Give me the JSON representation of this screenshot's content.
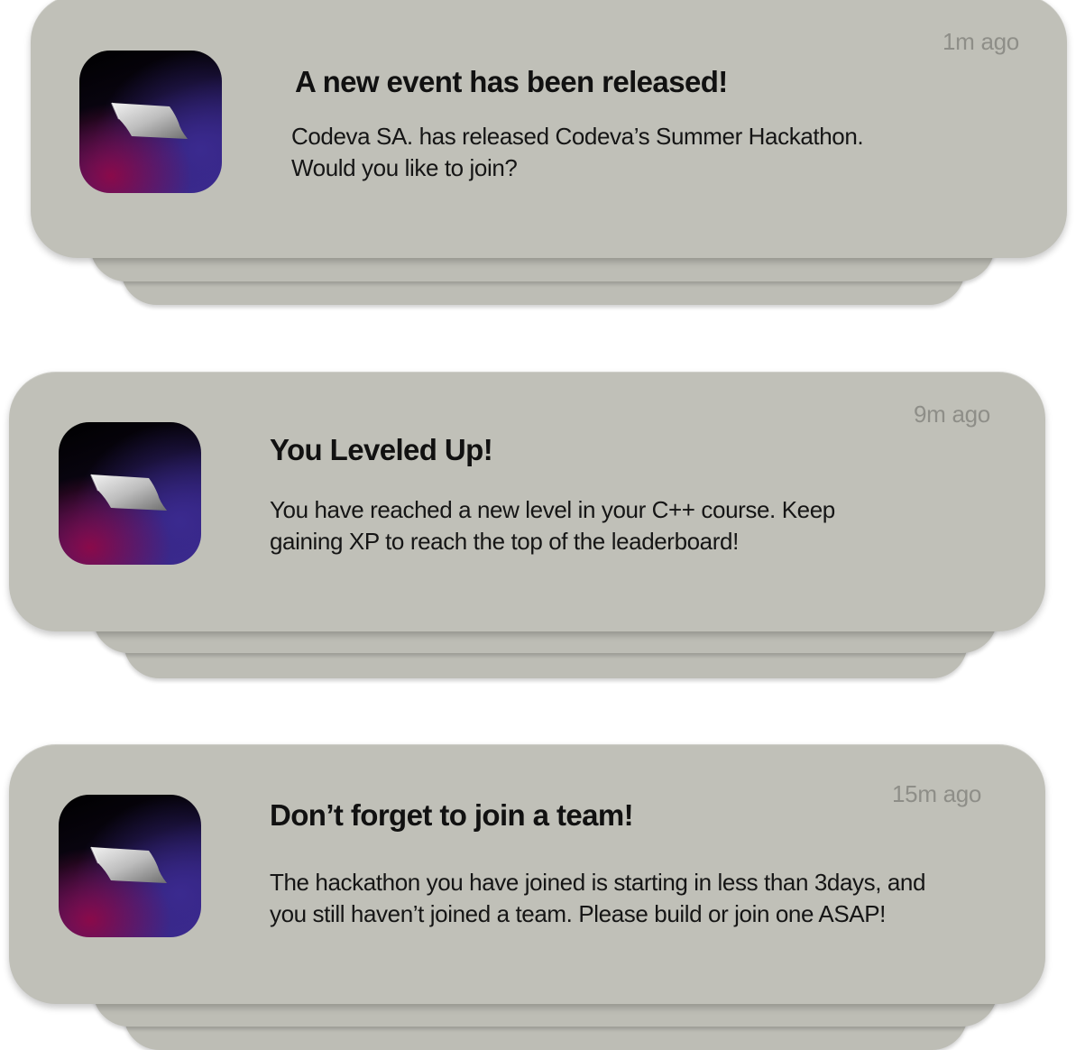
{
  "notifications": [
    {
      "time": "1m ago",
      "title": "A new event has been released!",
      "line1": "Codeva SA. has released Codeva’s Summer Hackathon.",
      "line2": "Would you like to join?",
      "icon": "codeva-app-icon"
    },
    {
      "time": "9m ago",
      "title": "You Leveled Up!",
      "line1": "You have reached a new level in your C++ course. Keep",
      "line2": "gaining XP to reach the top of the leaderboard!",
      "icon": "codeva-app-icon"
    },
    {
      "time": "15m ago",
      "title": "Don’t forget to join a team!",
      "line1": "The hackathon you have joined is starting in less than 3days, and",
      "line2": "you still haven’t joined a team. Please build or join one ASAP!",
      "icon": "codeva-app-icon"
    }
  ],
  "colors": {
    "card": "#c0c0b8",
    "time_text": "#8e8e88",
    "title_text": "#111111",
    "icon_dark": "#000000",
    "icon_purple": "#3b2a8f",
    "icon_magenta": "#8a0a4a"
  }
}
